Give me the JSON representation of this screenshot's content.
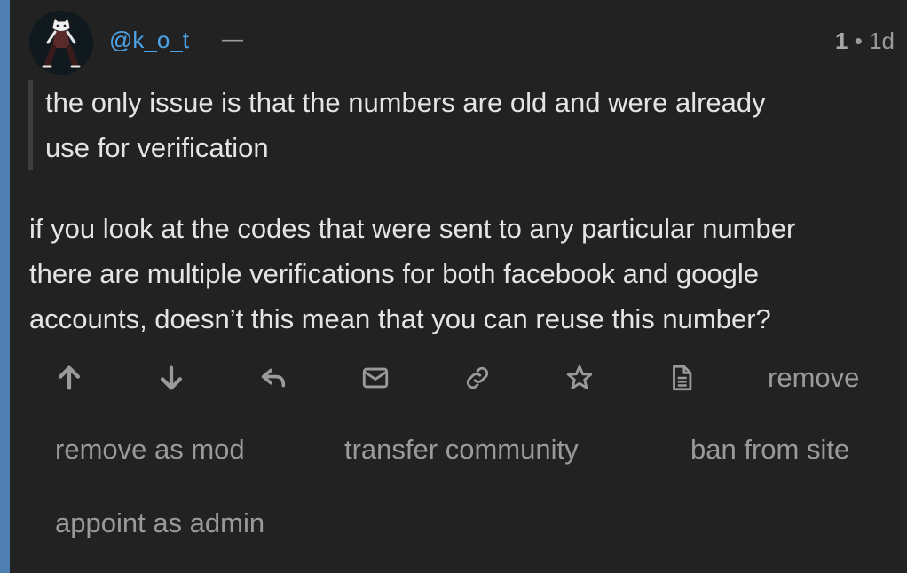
{
  "post": {
    "username": "@k_o_t",
    "separator": "—",
    "score": "1",
    "dot": "•",
    "age": "1d",
    "quote_lines": [
      "the only issue is that the numbers are old and were already",
      "use for verification"
    ],
    "body_lines": [
      "if you look at the codes that were sent to any particular number",
      "there are multiple verifications for both facebook and google",
      "accounts, doesn’t this mean that you can reuse this number?"
    ]
  },
  "actions": {
    "icons": [
      "arrow-up-icon",
      "arrow-down-icon",
      "reply-icon",
      "mail-icon",
      "link-icon",
      "star-icon",
      "document-icon"
    ],
    "remove": "remove",
    "remove_as_mod": "remove as mod",
    "transfer_community": "transfer community",
    "ban_from_site": "ban from site",
    "appoint_as_admin": "appoint as admin"
  },
  "colors": {
    "background": "#222222",
    "accent": "#4f7fb0",
    "username": "#4ca3e6",
    "muted": "#9a9a9a",
    "text": "#e4e4e4"
  }
}
